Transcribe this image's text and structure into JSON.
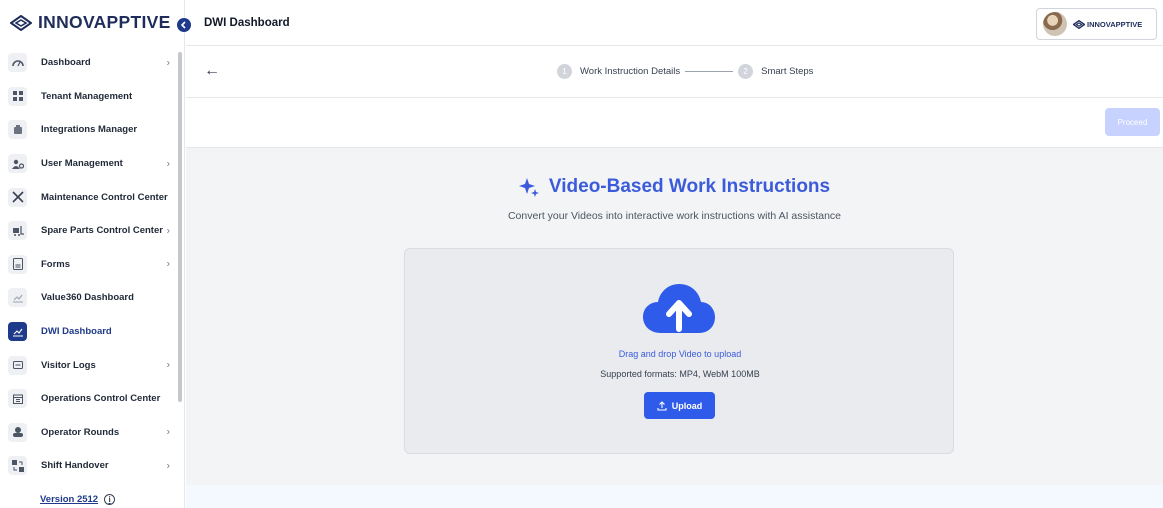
{
  "brand": {
    "name": "INNOVAPPTIVE"
  },
  "header": {
    "title": "DWI Dashboard",
    "user_brand": "INNOVAPPTIVE"
  },
  "sidebar": {
    "items": [
      {
        "label": "Dashboard",
        "icon": "speedometer-icon",
        "has_children": true,
        "active": false
      },
      {
        "label": "Tenant Management",
        "icon": "grid-icon",
        "has_children": false,
        "active": false
      },
      {
        "label": "Integrations Manager",
        "icon": "integration-icon",
        "has_children": false,
        "active": false
      },
      {
        "label": "User Management",
        "icon": "users-gear-icon",
        "has_children": true,
        "active": false
      },
      {
        "label": "Maintenance Control Center",
        "icon": "tools-icon",
        "has_children": false,
        "active": false
      },
      {
        "label": "Spare Parts Control Center",
        "icon": "forklift-icon",
        "has_children": true,
        "active": false
      },
      {
        "label": "Forms",
        "icon": "form-icon",
        "has_children": true,
        "active": false
      },
      {
        "label": "Value360 Dashboard",
        "icon": "chart-icon",
        "has_children": false,
        "active": false
      },
      {
        "label": "DWI Dashboard",
        "icon": "chart-icon",
        "has_children": false,
        "active": true
      },
      {
        "label": "Visitor Logs",
        "icon": "log-icon",
        "has_children": true,
        "active": false
      },
      {
        "label": "Operations Control Center",
        "icon": "calendar-icon",
        "has_children": false,
        "active": false
      },
      {
        "label": "Operator Rounds",
        "icon": "rounds-icon",
        "has_children": true,
        "active": false
      },
      {
        "label": "Shift Handover",
        "icon": "handover-icon",
        "has_children": true,
        "active": false
      }
    ],
    "version": "Version 2512"
  },
  "stepper": {
    "steps": [
      {
        "number": "1",
        "label": "Work Instruction Details"
      },
      {
        "number": "2",
        "label": "Smart Steps"
      }
    ]
  },
  "actions": {
    "proceed_label": "Proceed"
  },
  "main": {
    "title": "Video-Based Work Instructions",
    "subtitle": "Convert your Videos into interactive work instructions with AI assistance",
    "dropzone": {
      "primary": "Drag and drop Video to upload",
      "secondary": "Supported formats: MP4, WebM 100MB",
      "upload_label": "Upload"
    }
  },
  "colors": {
    "accent": "#3b5bdb",
    "nav_active": "#1e3a8a",
    "proceed_disabled": "#c7d2fe",
    "upload_button": "#2f5bea"
  }
}
